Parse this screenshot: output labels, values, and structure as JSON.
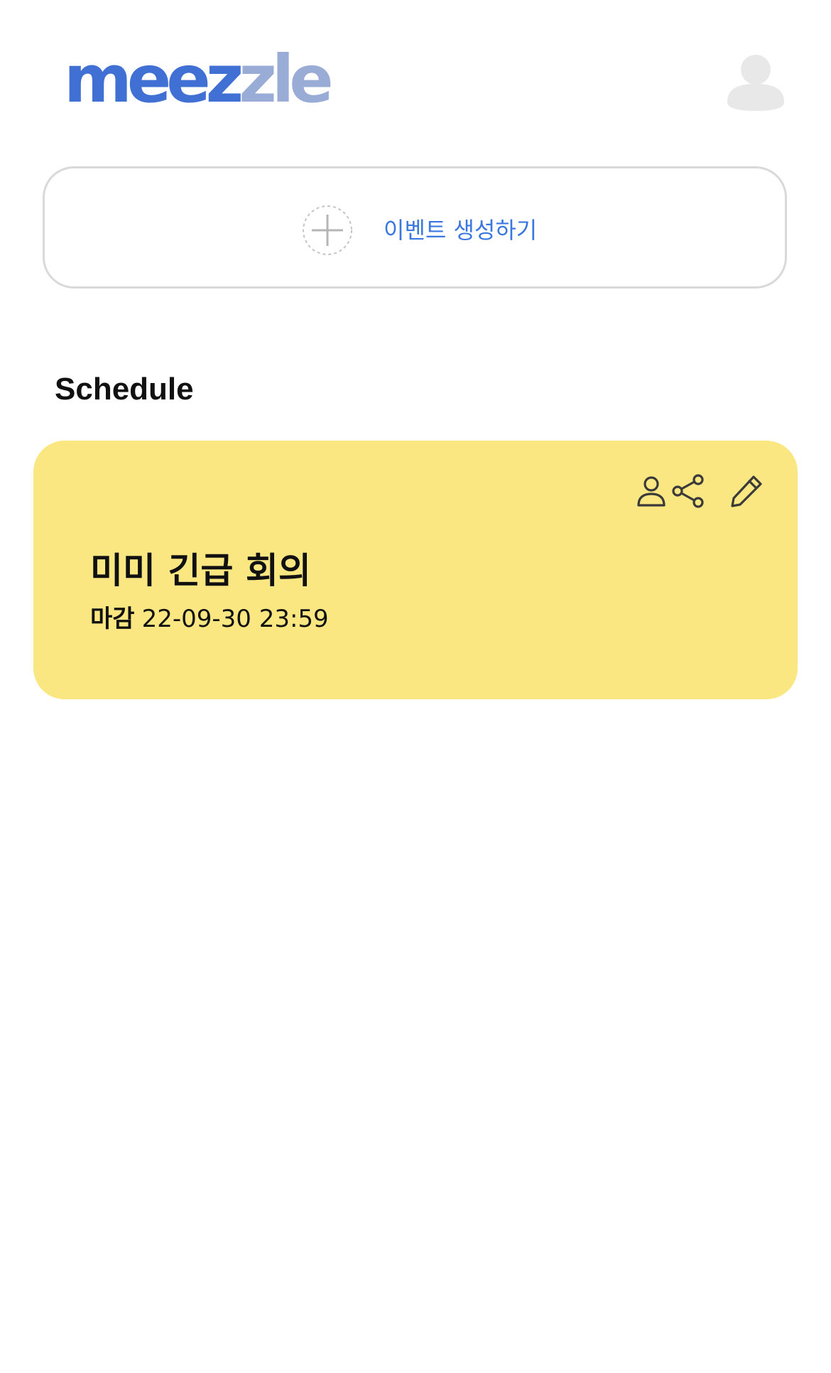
{
  "header": {
    "logo_part_a": "meez",
    "logo_part_b": "zle",
    "avatar_icon": "user-avatar-icon"
  },
  "create_event": {
    "label": "이벤트 생성하기",
    "icon": "plus-circle-icon"
  },
  "section": {
    "title": "Schedule"
  },
  "schedule": [
    {
      "title": "미미 긴급 회의",
      "deadline_label": "마감",
      "deadline_value": "22-09-30 23:59",
      "icons": [
        "person-icon",
        "share-icon",
        "pencil-icon"
      ]
    }
  ],
  "colors": {
    "brand_blue": "#4170d4",
    "brand_blue_light": "#98acd6",
    "link_blue": "#3a78e0",
    "card_yellow": "#fae782",
    "border_gray": "#d9d9d9",
    "avatar_gray": "#e8e8e8"
  }
}
